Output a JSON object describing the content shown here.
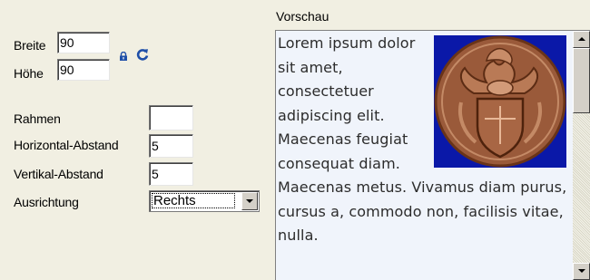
{
  "size": {
    "width_label": "Breite",
    "width_value": "90",
    "height_label": "Höhe",
    "height_value": "90",
    "lock_icon": "lock-icon",
    "reset_icon": "reset-icon"
  },
  "layout": {
    "border_label": "Rahmen",
    "border_value": "",
    "hspace_label": "Horizontal-Abstand",
    "hspace_value": "5",
    "vspace_label": "Vertikal-Abstand",
    "vspace_value": "5",
    "align_label": "Ausrichtung",
    "align_value": "Rechts"
  },
  "preview": {
    "title": "Vorschau",
    "text": "Lorem ipsum dolor sit amet, consectetuer adipiscing elit. Maecenas feugiat consequat diam. Maecenas metus. Vivamus diam purus, cursus a, commodo non, facilisis vitae, nulla."
  },
  "colors": {
    "image_background": "#0a18a8",
    "icon_blue": "#1f4fa8"
  }
}
